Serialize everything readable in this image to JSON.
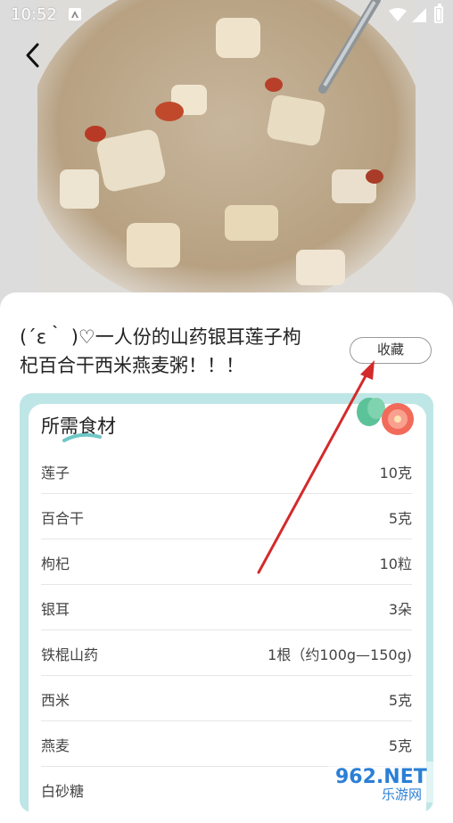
{
  "status_bar": {
    "time": "10:52"
  },
  "recipe": {
    "title_line1": "(´ε｀ )♡一人份的山药银耳莲子枸",
    "title_line2": "杞百合干西米燕麦粥！！！",
    "favorite_label": "收藏"
  },
  "ingredients": {
    "heading": "所需食材",
    "items": [
      {
        "name": "莲子",
        "amount": "10克"
      },
      {
        "name": "百合干",
        "amount": "5克"
      },
      {
        "name": "枸杞",
        "amount": "10粒"
      },
      {
        "name": "银耳",
        "amount": "3朵"
      },
      {
        "name": "铁棍山药",
        "amount": "1根（约100g—150g)"
      },
      {
        "name": "西米",
        "amount": "5克"
      },
      {
        "name": "燕麦",
        "amount": "5克"
      },
      {
        "name": "白砂糖",
        "amount": ""
      }
    ]
  },
  "watermark": {
    "brand": "962.NET",
    "subtitle": "乐游网"
  },
  "colors": {
    "card_bg": "#bfe6e6",
    "arrow": "#d42a2a",
    "accent_text": "#222222"
  },
  "icons": {
    "back": "chevron-left-icon",
    "wifi": "wifi-icon",
    "signal": "signal-icon",
    "battery": "battery-icon"
  }
}
